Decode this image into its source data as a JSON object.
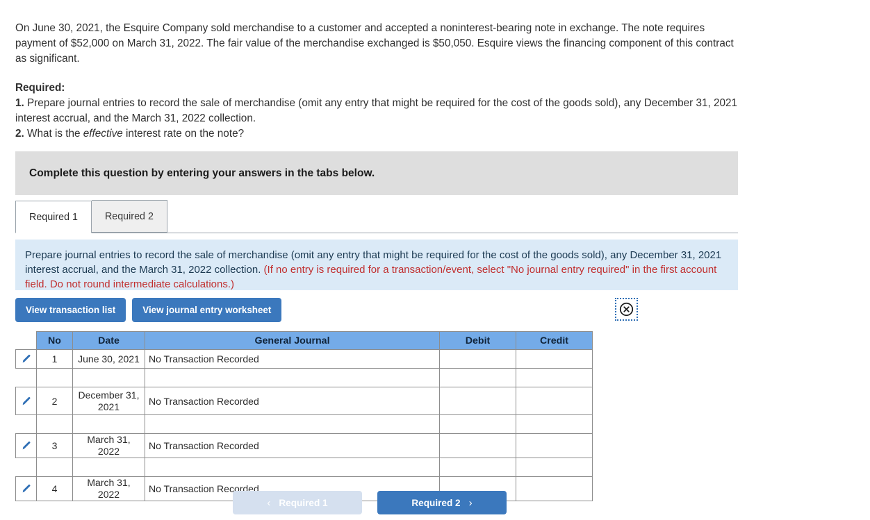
{
  "problem": {
    "statement": "On June 30, 2021, the Esquire Company sold merchandise to a customer and accepted a noninterest-bearing note in exchange. The note requires payment of $52,000 on March 31, 2022. The fair value of the merchandise exchanged is $50,050. Esquire views the financing component of this contract as significant.",
    "required_heading": "Required:",
    "items": [
      {
        "number": "1.",
        "text_before_em": " Prepare journal entries to record the sale of merchandise (omit any entry that might be required for the cost of the goods sold), any December 31, 2021 interest accrual, and the March 31, 2022 collection.",
        "em": "",
        "text_after_em": ""
      },
      {
        "number": "2.",
        "text_before_em": " What is the ",
        "em": "effective",
        "text_after_em": " interest rate on the note?"
      }
    ]
  },
  "banner": {
    "text": "Complete this question by entering your answers in the tabs below."
  },
  "tabs": [
    {
      "label": "Required 1",
      "active": true
    },
    {
      "label": "Required 2",
      "active": false
    }
  ],
  "instruction": {
    "black_text": "Prepare journal entries to record the sale of merchandise (omit any entry that might be required for the cost of the goods sold), any December 31, 2021 interest accrual, and the March 31, 2022 collection. ",
    "red_text": "(If no entry is required for a transaction/event, select \"No journal entry required\" in the first account field. Do not round intermediate calculations.)"
  },
  "toolbar": {
    "view_transaction_list": "View transaction list",
    "view_journal_entry_worksheet": "View journal entry worksheet",
    "close_icon": "circle-x-icon"
  },
  "table": {
    "headers": [
      "No",
      "Date",
      "General Journal",
      "Debit",
      "Credit"
    ],
    "rows": [
      {
        "no": "1",
        "date": "June 30, 2021",
        "general_journal": "No Transaction Recorded",
        "debit": "",
        "credit": "",
        "edit_icon": "pencil-icon"
      },
      {
        "no": "2",
        "date": "December 31, 2021",
        "general_journal": "No Transaction Recorded",
        "debit": "",
        "credit": "",
        "edit_icon": "pencil-icon"
      },
      {
        "no": "3",
        "date": "March 31, 2022",
        "general_journal": "No Transaction Recorded",
        "debit": "",
        "credit": "",
        "edit_icon": "pencil-icon"
      },
      {
        "no": "4",
        "date": "March 31, 2022",
        "general_journal": "No Transaction Recorded",
        "debit": "",
        "credit": "",
        "edit_icon": "pencil-icon"
      }
    ]
  },
  "footer": {
    "prev_label": "Required 1",
    "next_label": "Required 2",
    "prev_chevron": "chevron-left-icon",
    "next_chevron": "chevron-right-icon",
    "prev_disabled": true
  },
  "colors": {
    "button_blue": "#3b78bd",
    "table_header_blue": "#74abe8",
    "instruction_bg": "#dbeaf7",
    "banner_gray": "#dedede",
    "red_text": "#c12f2f",
    "disabled_button": "#d5e0ef"
  }
}
